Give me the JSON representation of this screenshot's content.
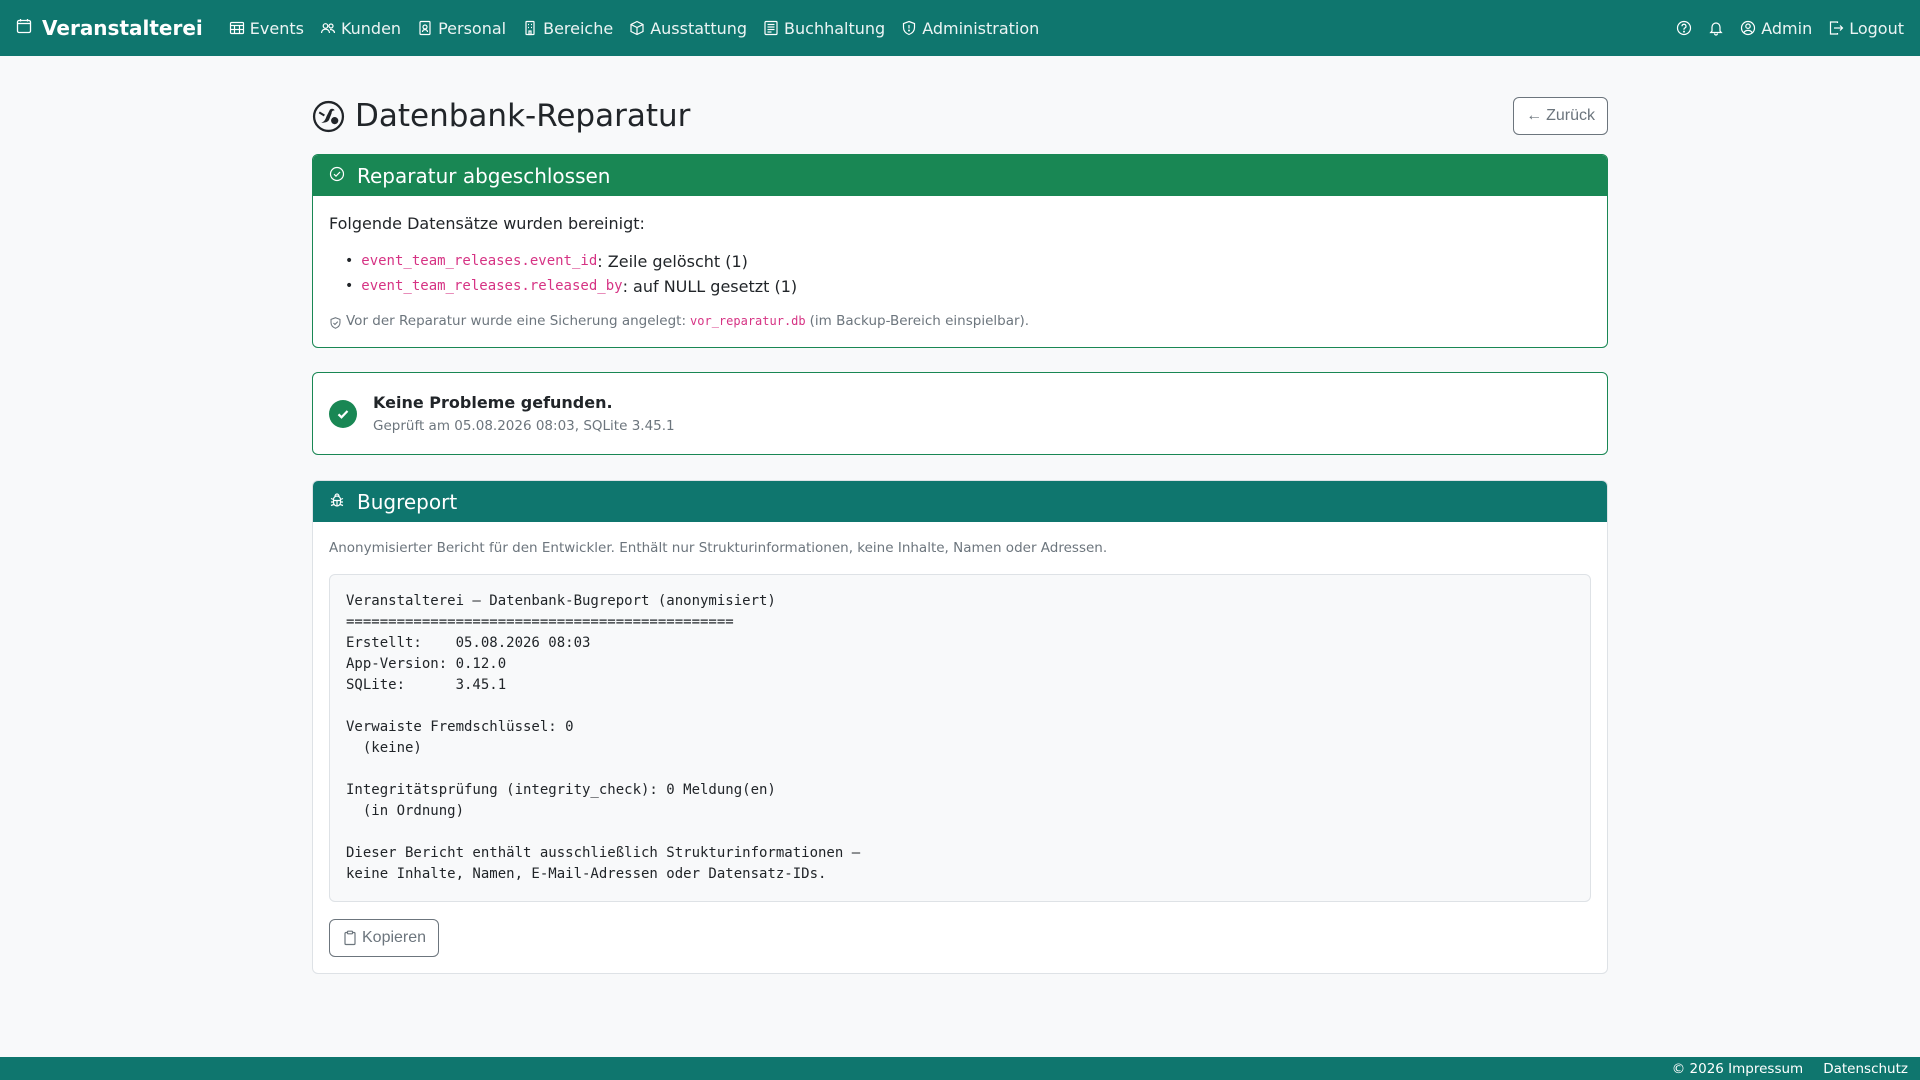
{
  "nav": {
    "brand": "Veranstalterei",
    "items": [
      {
        "label": "Events",
        "icon": "calendar-grid-icon"
      },
      {
        "label": "Kunden",
        "icon": "people-icon"
      },
      {
        "label": "Personal",
        "icon": "badge-icon"
      },
      {
        "label": "Bereiche",
        "icon": "building-icon"
      },
      {
        "label": "Ausstattung",
        "icon": "box-icon"
      },
      {
        "label": "Buchhaltung",
        "icon": "ledger-icon"
      },
      {
        "label": "Administration",
        "icon": "shield-icon"
      }
    ],
    "user": "Admin",
    "logout": "Logout"
  },
  "page": {
    "title": "Datenbank-Reparatur",
    "back_label": "Zurück"
  },
  "repair": {
    "title": "Reparatur abgeschlossen",
    "intro": "Folgende Datensätze wurden bereinigt:",
    "items": [
      {
        "field": "event_team_releases.event_id",
        "text": ": Zeile gelöscht (1)"
      },
      {
        "field": "event_team_releases.released_by",
        "text": ": auf NULL gesetzt (1)"
      }
    ],
    "backup_prefix": "Vor der Reparatur wurde eine Sicherung angelegt:",
    "backup_file": "vor_reparatur.db",
    "backup_suffix": "(im Backup-Bereich einspielbar)."
  },
  "check": {
    "title": "Keine Probleme gefunden.",
    "subtitle": "Geprüft am 05.08.2026 08:03, SQLite 3.45.1"
  },
  "bugreport": {
    "title": "Bugreport",
    "description": "Anonymisierter Bericht für den Entwickler. Enthält nur Strukturinformationen, keine Inhalte, Namen oder Adressen.",
    "report": "Veranstalterei – Datenbank-Bugreport (anonymisiert)\n==============================================\nErstellt:    05.08.2026 08:03\nApp-Version: 0.12.0\nSQLite:      3.45.1\n\nVerwaiste Fremdschlüssel: 0\n  (keine)\n\nIntegritätsprüfung (integrity_check): 0 Meldung(en)\n  (in Ordnung)\n\nDieser Bericht enthält ausschließlich Strukturinformationen –\nkeine Inhalte, Namen, E-Mail-Adressen oder Datensatz-IDs.",
    "copy_label": "Kopieren"
  },
  "footer": {
    "copyright": "© 2026 Impressum",
    "privacy": "Datenschutz"
  },
  "colors": {
    "primary": "#0f766e",
    "success": "#198754",
    "code": "#d63384"
  }
}
